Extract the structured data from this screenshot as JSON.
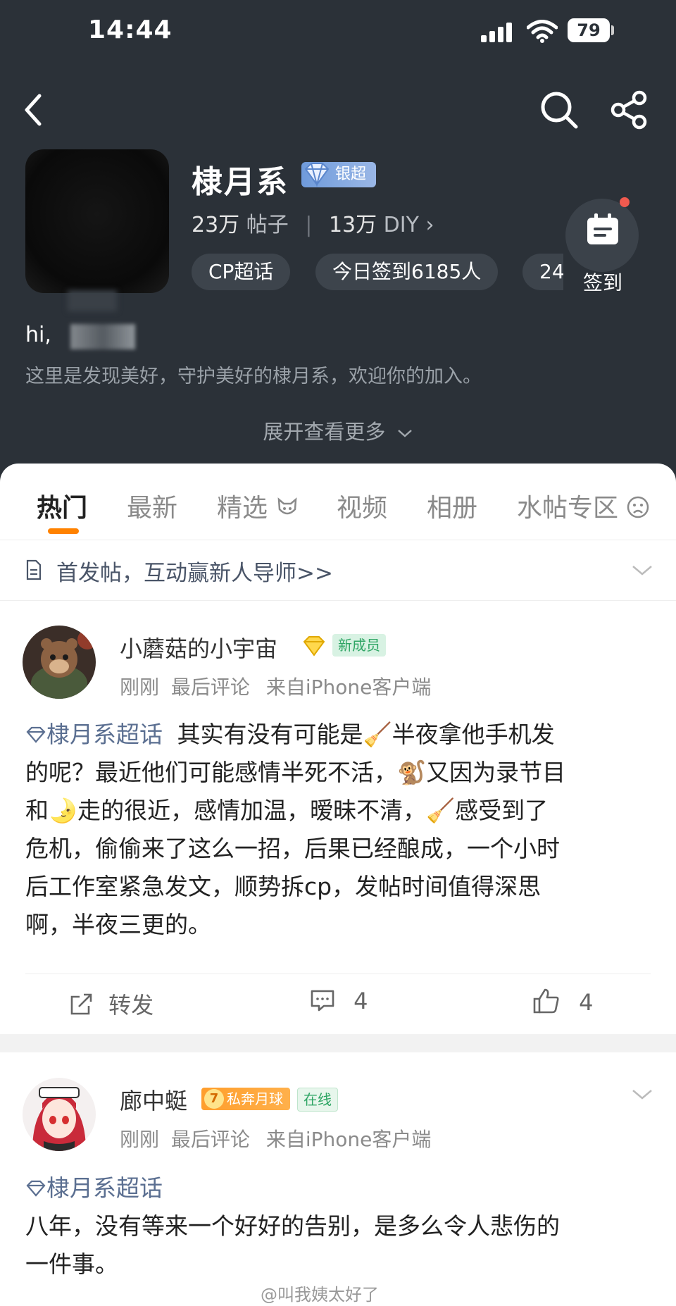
{
  "status_bar": {
    "time": "14:44",
    "battery": "79"
  },
  "group": {
    "name": "棣月系",
    "badge": "银超",
    "posts_count": "23万",
    "posts_label": "帖子",
    "diy_count": "13万",
    "diy_label": "DIY",
    "chips": [
      "CP超话",
      "今日签到6185人",
      "24"
    ],
    "signin_label": "签到",
    "greeting": "hi,",
    "description": "这里是发现美好，守护美好的棣月系，欢迎你的加入。",
    "expand_label": "展开查看更多"
  },
  "tabs": [
    "热门",
    "最新",
    "精选",
    "视频",
    "相册",
    "水帖专区"
  ],
  "notice": {
    "text": "首发帖，互动赢新人导师>>"
  },
  "posts": [
    {
      "username": "小蘑菇的小宇宙",
      "badge": "新成员",
      "time": "刚刚",
      "last_comment": "最后评论",
      "source": "来自iPhone客户端",
      "topic": "棣月系超话",
      "lines": [
        "其实有没有可能是🧹半夜拿他手机发",
        "的呢？最近他们可能感情半死不活，🐒又因为录节目",
        "和🌛走的很近，感情加温，暧昧不清，🧹感受到了",
        "危机，偷偷来了这么一招，后果已经酿成，一个小时",
        "后工作室紧急发文，顺势拆cp，发帖时间值得深思",
        "啊，半夜三更的。"
      ],
      "repost_label": "转发",
      "comments": "4",
      "likes": "4"
    },
    {
      "username": "廊中蜓",
      "level": "7",
      "badge": "私奔月球",
      "status": "在线",
      "time": "刚刚",
      "last_comment": "最后评论",
      "source": "来自iPhone客户端",
      "topic": "棣月系超话",
      "lines": [
        "八年，没有等来一个好好的告别，是多么令人悲伤的",
        "一件事。"
      ]
    }
  ],
  "watermark": "@叫我姨太好了",
  "colors": {
    "header_bg": "#2b3138",
    "accent": "#ff8200",
    "topic": "#5b6f91"
  }
}
